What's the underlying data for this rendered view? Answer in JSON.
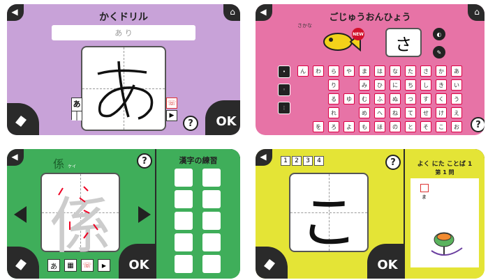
{
  "panel1": {
    "title": "かくドリル",
    "answer_hint": "あ り",
    "character": "あ",
    "ref_char": "あ",
    "ok_label": "OK",
    "help_label": "?",
    "colors": {
      "bg": "#c8a2d8"
    }
  },
  "panel2": {
    "title": "ごじゅうおんひょう",
    "fish_label": "さかな",
    "new_badge": "NEW",
    "selected_char": "さ",
    "help_label": "?",
    "colors": {
      "bg": "#e773a6"
    },
    "side_left": [
      "",
      "",
      ""
    ],
    "kana_rows": [
      [
        "ん",
        "わ",
        "ら",
        "や",
        "ま",
        "は",
        "な",
        "た",
        "さ",
        "か",
        "あ"
      ],
      [
        "",
        "",
        "り",
        "",
        "み",
        "ひ",
        "に",
        "ち",
        "し",
        "き",
        "い"
      ],
      [
        "",
        "",
        "る",
        "ゆ",
        "む",
        "ふ",
        "ぬ",
        "つ",
        "す",
        "く",
        "う"
      ],
      [
        "",
        "",
        "れ",
        "",
        "め",
        "へ",
        "ね",
        "て",
        "せ",
        "け",
        "え"
      ],
      [
        "",
        "を",
        "ろ",
        "よ",
        "も",
        "ほ",
        "の",
        "と",
        "そ",
        "こ",
        "お"
      ]
    ]
  },
  "panel3": {
    "kanji": "係",
    "kanji_reading": "ケイ",
    "practice_title": "漢字の練習",
    "ok_label": "OK",
    "help_label": "?",
    "tool_hiragana": "あ",
    "colors": {
      "bg": "#3fae5a"
    }
  },
  "panel4": {
    "numbers": [
      "1",
      "2",
      "3",
      "4"
    ],
    "character": "こ",
    "quiz_title": "よく にた ことば 1",
    "quiz_sub": "第 1 問",
    "quiz_answer_char": "ま",
    "ok_label": "OK",
    "help_label": "?",
    "colors": {
      "bg": "#e4e436"
    }
  }
}
